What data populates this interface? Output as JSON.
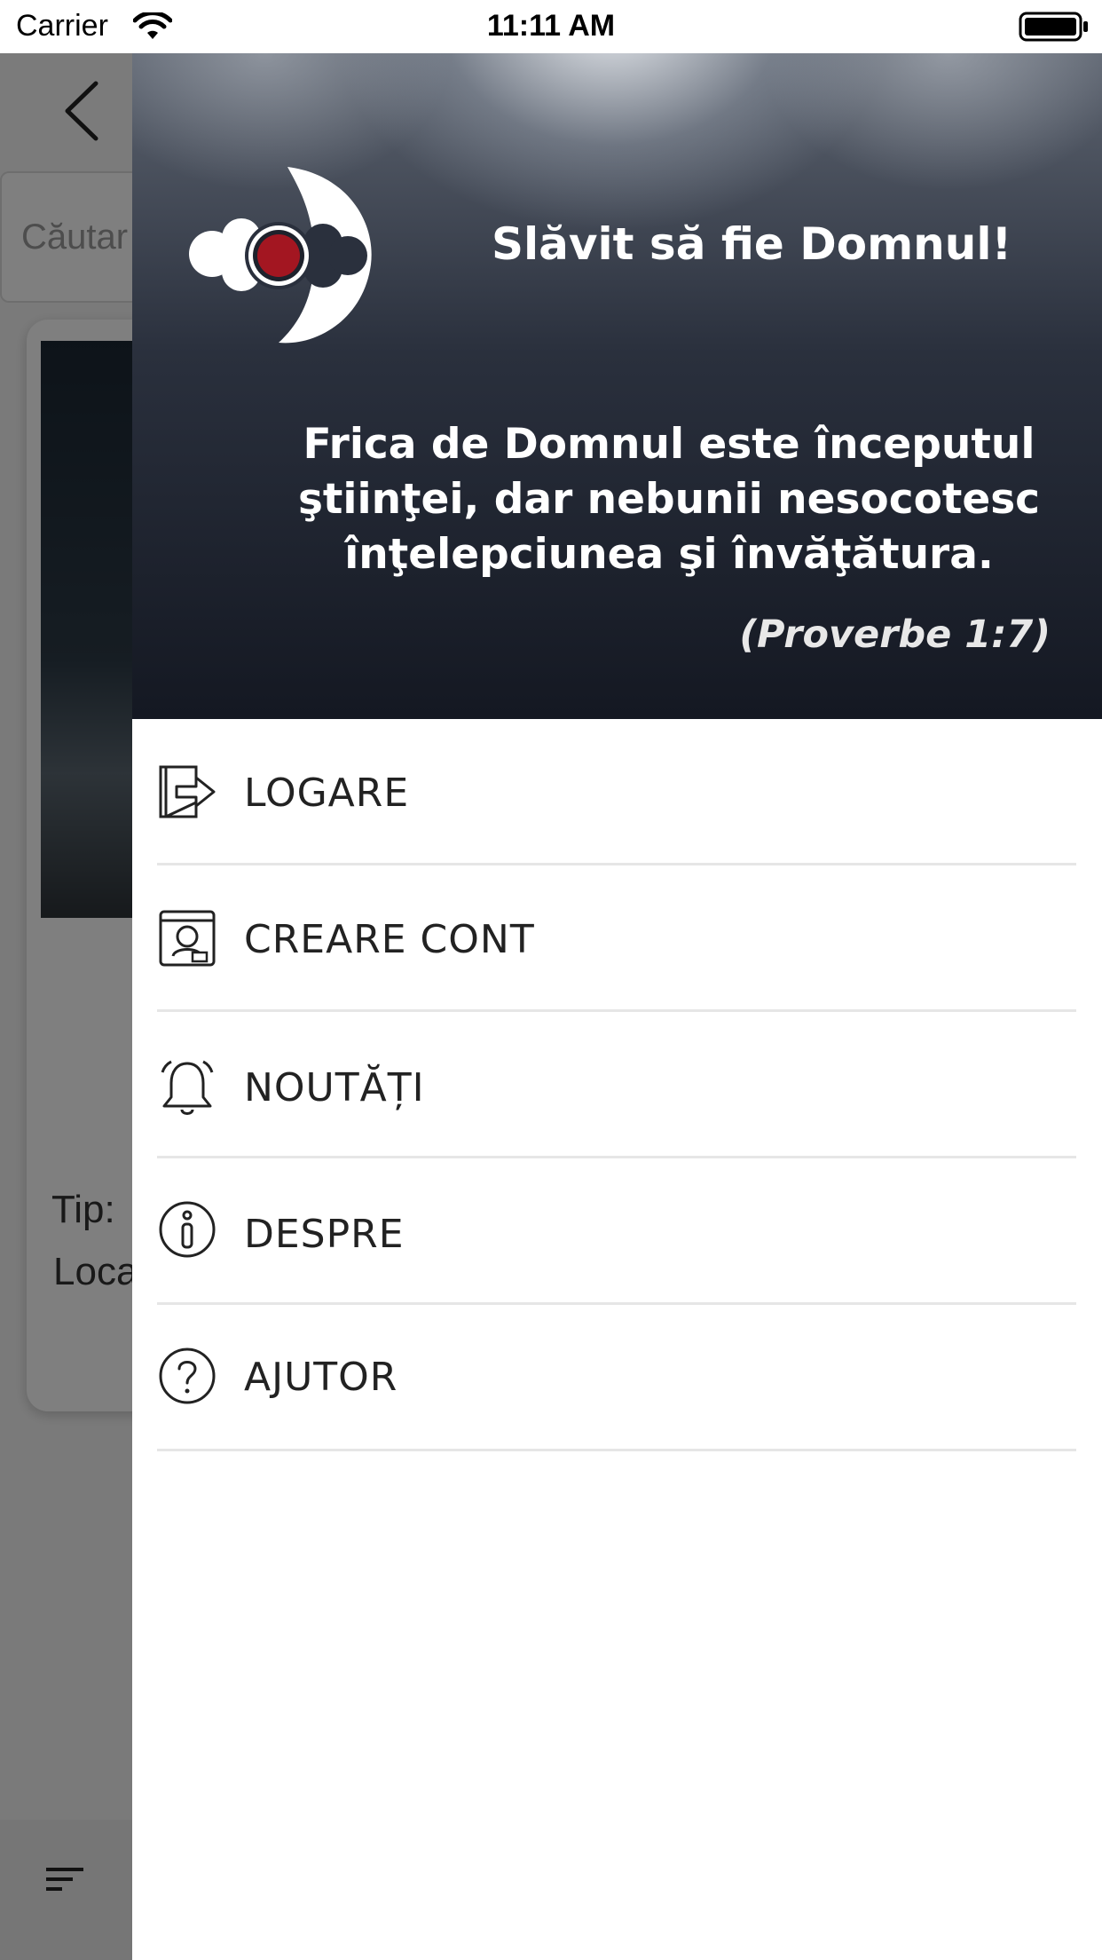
{
  "status_bar": {
    "carrier": "Carrier",
    "time": "11:11 AM"
  },
  "background": {
    "search_placeholder": "Căutar",
    "card_tip": "Tip:",
    "card_loc": "Loca"
  },
  "drawer": {
    "title": "Slăvit să fie Domnul!",
    "quote": "Frica de Domnul este începutul ştiinţei, dar nebunii nesocotesc înţelepciunea şi învăţătura.",
    "reference": "(Proverbe 1:7)",
    "accent_color": "#a31621",
    "menu": [
      {
        "label": "LOGARE",
        "icon": "login-icon"
      },
      {
        "label": "CREARE CONT",
        "icon": "create-account-icon"
      },
      {
        "label": "NOUTĂȚI",
        "icon": "bell-icon"
      },
      {
        "label": "DESPRE",
        "icon": "info-icon"
      },
      {
        "label": "AJUTOR",
        "icon": "help-icon"
      }
    ]
  }
}
